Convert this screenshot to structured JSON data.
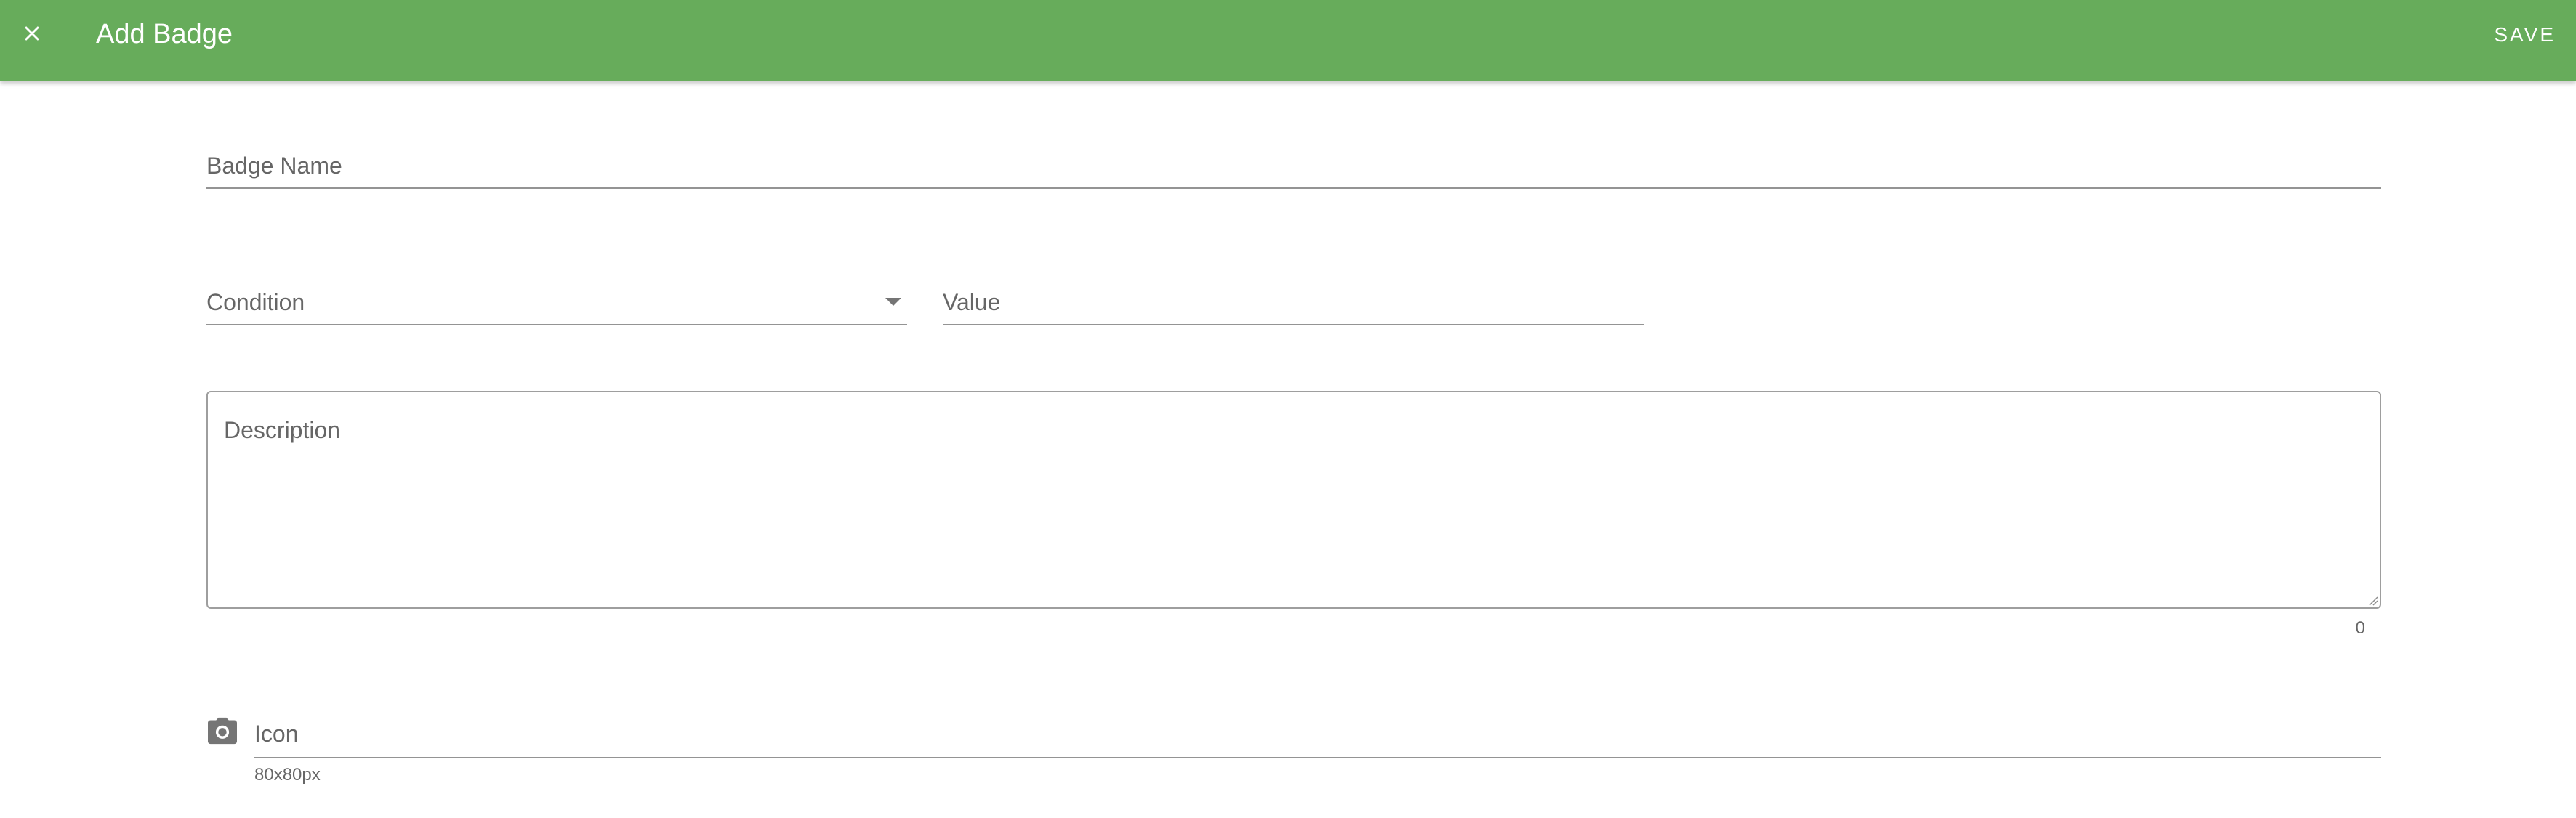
{
  "toolbar": {
    "title": "Add Badge",
    "close_icon": "close-icon",
    "save_label": "SAVE",
    "background_color": "#67ac5b"
  },
  "form": {
    "badge_name": {
      "label": "Badge Name",
      "value": ""
    },
    "condition": {
      "label": "Condition",
      "selected": "",
      "icon": "arrow-drop-down-icon"
    },
    "value": {
      "label": "Value",
      "value": ""
    },
    "description": {
      "label": "Description",
      "value": "",
      "char_count": "0"
    },
    "icon": {
      "label": "Icon",
      "hint": "80x80px",
      "icon": "camera-icon"
    }
  }
}
